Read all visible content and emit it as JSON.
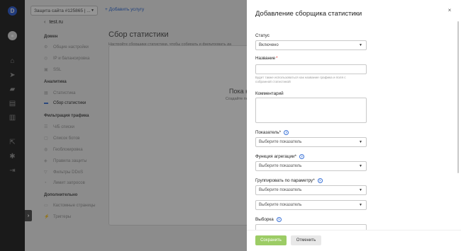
{
  "rail": {
    "logo": "D",
    "icons": [
      "user-circle-icon",
      "home-icon",
      "send-icon",
      "briefcase-icon",
      "document-icon",
      "server-icon",
      "external-link-icon",
      "gear-icon",
      "logout-icon"
    ]
  },
  "header": {
    "site_select": "Защита сайта #125865 | ...",
    "add_service": "+ Добавить услугу"
  },
  "sidebar": {
    "back": "test.ru",
    "sections": [
      {
        "title": "Домен",
        "items": [
          "Общие настройки",
          "IP и балансировка",
          "SSL"
        ]
      },
      {
        "title": "Аналитика",
        "items": [
          "Статистика",
          "Сбор статистики"
        ]
      },
      {
        "title": "Фильтрация трафика",
        "items": [
          "Ч/Б списки",
          "Список ботов",
          "Геоблокировка",
          "Правила защиты",
          "Фильтры DDoS",
          "Лимит запросов"
        ]
      },
      {
        "title": "Дополнительно",
        "items": [
          "Кастомные страницы",
          "Триггеры"
        ]
      }
    ],
    "active_item": "Сбор статистики"
  },
  "main": {
    "title": "Сбор статистики",
    "subtitle": "Настройте сборщики статистики, чтобы собирать и фильтровать да",
    "empty_title": "Пока н",
    "empty_subtitle": "Создайте первый сбор"
  },
  "drawer": {
    "title": "Добавление сборщика статистики",
    "close": "×",
    "status_label": "Статус",
    "status_value": "Включено",
    "name_label": "Название",
    "name_value": "",
    "name_hint": "Будет также использоваться как название графика и поля с собранной статистикой",
    "comment_label": "Комментарий",
    "indicator_label": "Показатель*",
    "indicator_placeholder": "Выберите показатель",
    "aggregation_label": "Функция агрегации*",
    "aggregation_placeholder": "Выберите показатель",
    "group_label": "Группировать по параметру*",
    "group_placeholder_1": "Выберите показатель",
    "group_placeholder_2": "Выберите показатель",
    "selection_label": "Выборка",
    "save": "Сохранить",
    "cancel": "Отменить"
  },
  "colors": {
    "accent": "#3b73d8",
    "save_button": "#9ccc65",
    "required": "#e53935"
  }
}
